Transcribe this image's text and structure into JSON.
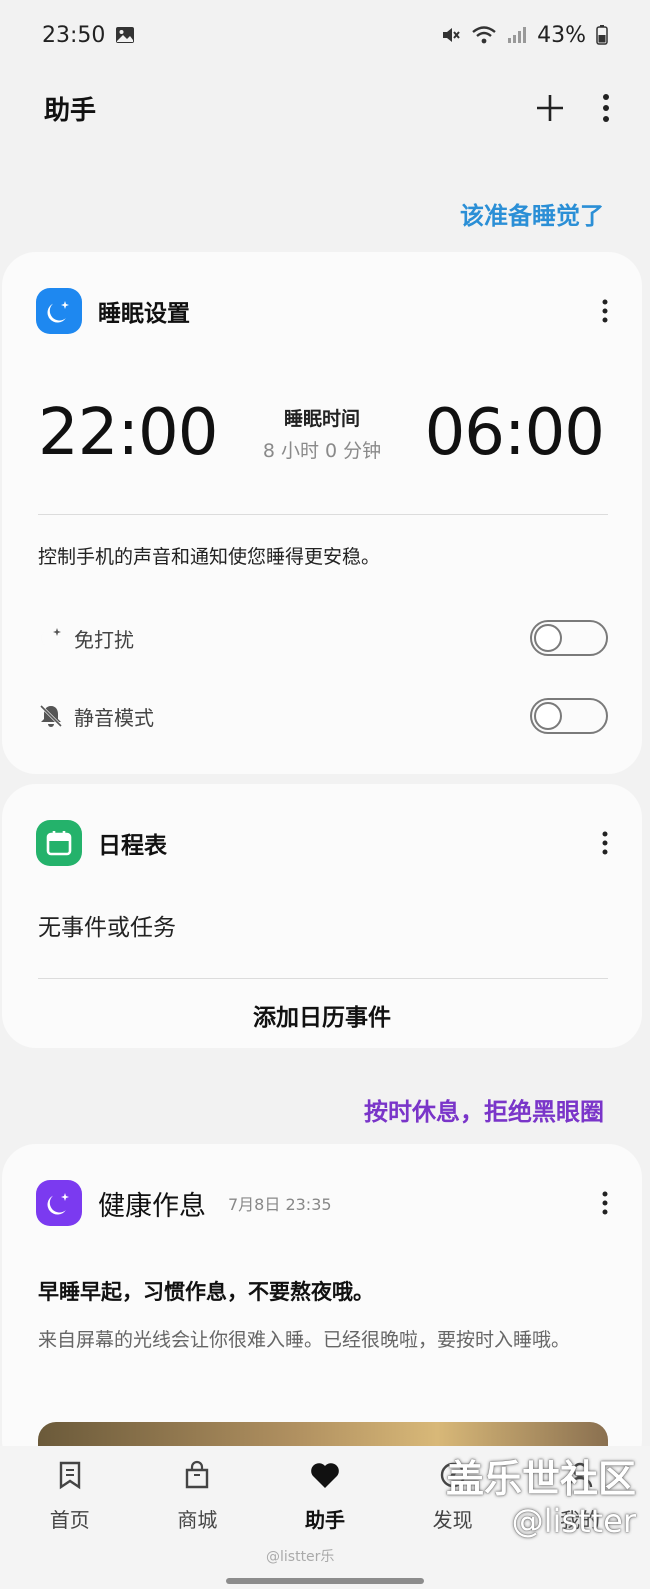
{
  "status_bar": {
    "time": "23:50",
    "battery": "43%",
    "icons": [
      "image-icon",
      "mute-icon",
      "wifi-icon",
      "signal-icon",
      "battery-icon"
    ]
  },
  "app_bar": {
    "title": "助手",
    "actions": [
      "add-icon",
      "more-vertical-icon"
    ]
  },
  "sleep_hint": "该准备睡觉了",
  "sleep_card": {
    "title": "睡眠设置",
    "bedtime": "22:00",
    "wake_time": "06:00",
    "sleep_label": "睡眠时间",
    "duration": "8 小时 0 分钟",
    "description": "控制手机的声音和通知使您睡得更安稳。",
    "options": [
      {
        "label": "免打扰",
        "icon": "moon-icon",
        "enabled": false
      },
      {
        "label": "静音模式",
        "icon": "bell-off-icon",
        "enabled": false
      }
    ],
    "accent": "#1e88f0"
  },
  "calendar_card": {
    "title": "日程表",
    "empty_text": "无事件或任务",
    "add_button": "添加日历事件",
    "accent": "#24b26b"
  },
  "health_hint": "按时休息，拒绝黑眼圈",
  "health_card": {
    "title": "健康作息",
    "timestamp": "7月8日 23:35",
    "headline": "早睡早起，习惯作息，不要熬夜哦。",
    "body": "来自屏幕的光线会让你很难入睡。已经很晚啦，要按时入睡哦。",
    "accent": "#7b3af0"
  },
  "bottom_nav": {
    "items": [
      {
        "label": "首页",
        "icon": "bookmark-icon"
      },
      {
        "label": "商城",
        "icon": "shopping-bag-icon"
      },
      {
        "label": "助手",
        "icon": "heart-icon",
        "active": true
      },
      {
        "label": "发现",
        "icon": "compass-icon"
      },
      {
        "label": "我的",
        "icon": "user-icon"
      }
    ]
  },
  "watermark": {
    "line1": "盖乐世社区",
    "line2": "@listter",
    "bottom_text": "@listter乐"
  },
  "colors": {
    "hint_blue": "#2b8fd6",
    "hint_purple": "#7a35c9"
  }
}
